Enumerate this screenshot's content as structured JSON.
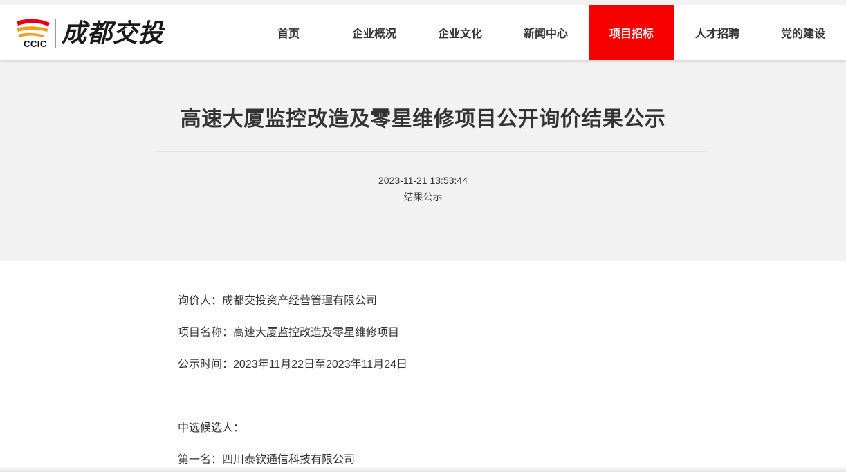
{
  "brand": {
    "logo_abbr": "CCIC",
    "logo_name": "成都交投",
    "colors": {
      "red": "#e60012",
      "gold": "#f0a020"
    }
  },
  "nav": {
    "items": [
      {
        "label": "首页"
      },
      {
        "label": "企业概况"
      },
      {
        "label": "企业文化"
      },
      {
        "label": "新闻中心"
      },
      {
        "label": "项目招标"
      },
      {
        "label": "人才招聘"
      },
      {
        "label": "党的建设"
      }
    ],
    "active_label": "项目招标",
    "active_color": "#f60000"
  },
  "article": {
    "title": "高速大厦监控改造及零星维修项目公开询价结果公示",
    "date": "2023-11-21 13:53:44",
    "category": "结果公示",
    "lines": [
      "询价人：成都交投资产经营管理有限公司",
      "项目名称：高速大厦监控改造及零星维修项目",
      "公示时间：2023年11月22日至2023年11月24日",
      "中选候选人：",
      "第一名：四川泰钦通信科技有限公司"
    ]
  }
}
